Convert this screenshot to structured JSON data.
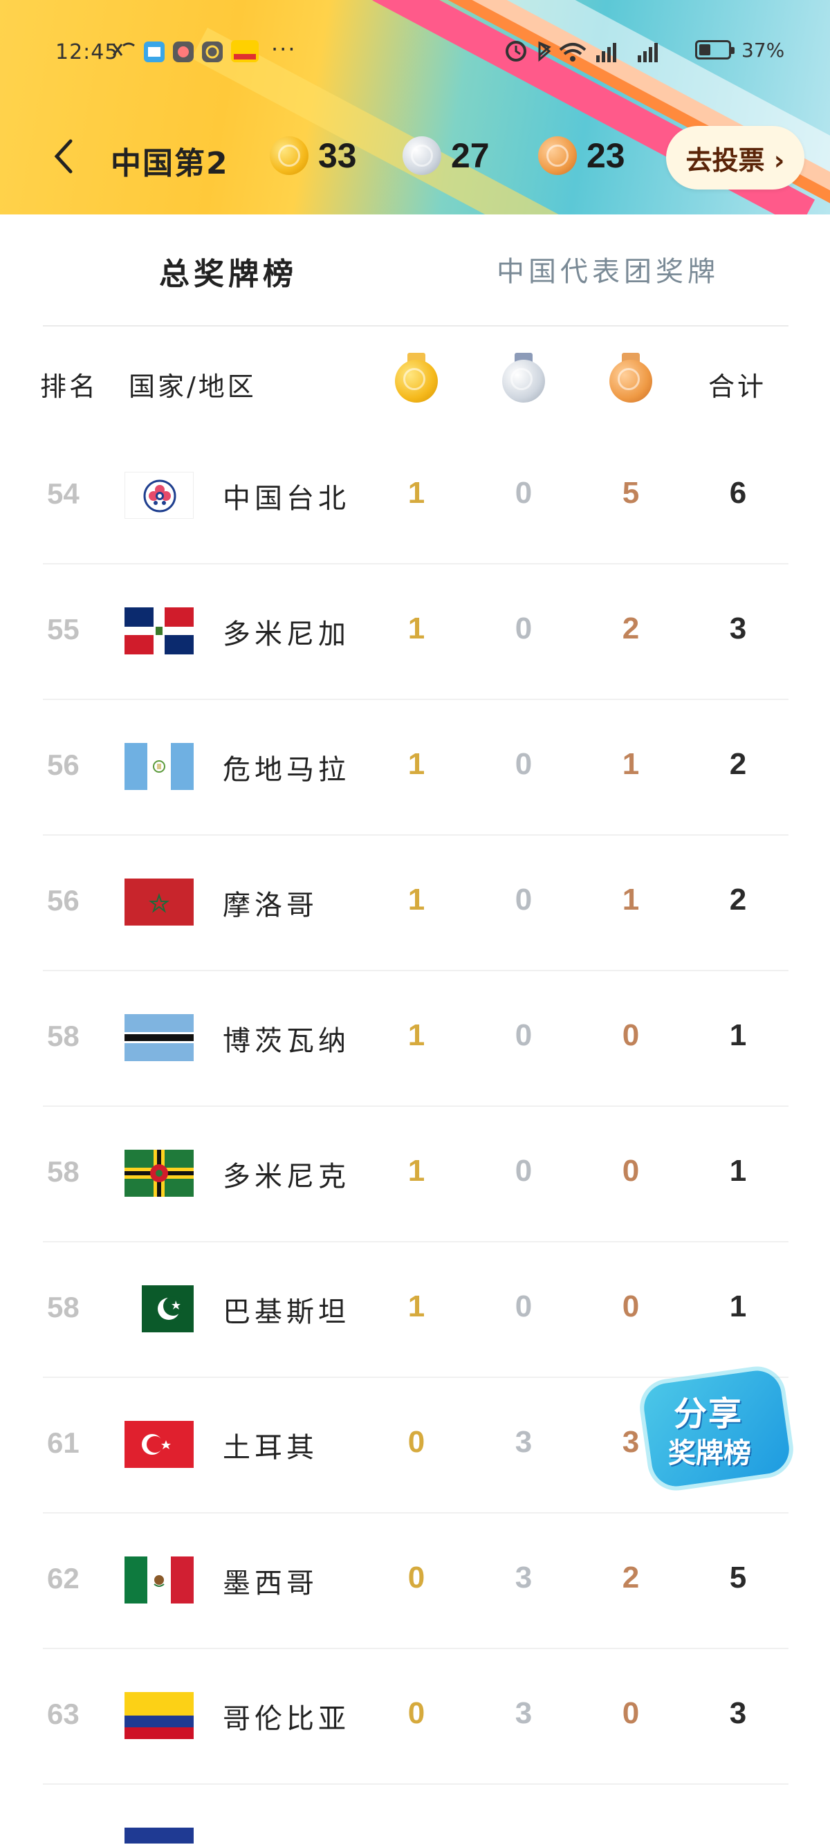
{
  "status_bar": {
    "time": "12:45",
    "battery": "37%",
    "more": "···"
  },
  "header": {
    "rank_title": "中国第2",
    "gold": "33",
    "silver": "27",
    "bronze": "23",
    "vote_label": "去投票 ›"
  },
  "tabs": [
    {
      "label": "总奖牌榜",
      "active": true
    },
    {
      "label": "中国代表团奖牌",
      "active": false
    }
  ],
  "table_header": {
    "rank": "排名",
    "country": "国家/地区",
    "total": "合计"
  },
  "rows": [
    {
      "rank": "54",
      "country": "中国台北",
      "flag": "chinese-taipei-flag",
      "gold": "1",
      "silver": "0",
      "bronze": "5",
      "total": "6"
    },
    {
      "rank": "55",
      "country": "多米尼加",
      "flag": "dominican-republic-flag",
      "gold": "1",
      "silver": "0",
      "bronze": "2",
      "total": "3"
    },
    {
      "rank": "56",
      "country": "危地马拉",
      "flag": "guatemala-flag",
      "gold": "1",
      "silver": "0",
      "bronze": "1",
      "total": "2"
    },
    {
      "rank": "56",
      "country": "摩洛哥",
      "flag": "morocco-flag",
      "gold": "1",
      "silver": "0",
      "bronze": "1",
      "total": "2"
    },
    {
      "rank": "58",
      "country": "博茨瓦纳",
      "flag": "botswana-flag",
      "gold": "1",
      "silver": "0",
      "bronze": "0",
      "total": "1"
    },
    {
      "rank": "58",
      "country": "多米尼克",
      "flag": "dominica-flag",
      "gold": "1",
      "silver": "0",
      "bronze": "0",
      "total": "1"
    },
    {
      "rank": "58",
      "country": "巴基斯坦",
      "flag": "pakistan-flag",
      "gold": "1",
      "silver": "0",
      "bronze": "0",
      "total": "1"
    },
    {
      "rank": "61",
      "country": "土耳其",
      "flag": "turkey-flag",
      "gold": "0",
      "silver": "3",
      "bronze": "3",
      "total": ""
    },
    {
      "rank": "62",
      "country": "墨西哥",
      "flag": "mexico-flag",
      "gold": "0",
      "silver": "3",
      "bronze": "2",
      "total": "5"
    },
    {
      "rank": "63",
      "country": "哥伦比亚",
      "flag": "colombia-flag",
      "gold": "0",
      "silver": "3",
      "bronze": "0",
      "total": "3"
    }
  ],
  "share": {
    "line1": "分享",
    "line2": "奖牌榜"
  },
  "colors": {
    "gold_text": "#d6aa3d",
    "silver_text": "#b7bcc2",
    "bronze_text": "#c0835a"
  }
}
